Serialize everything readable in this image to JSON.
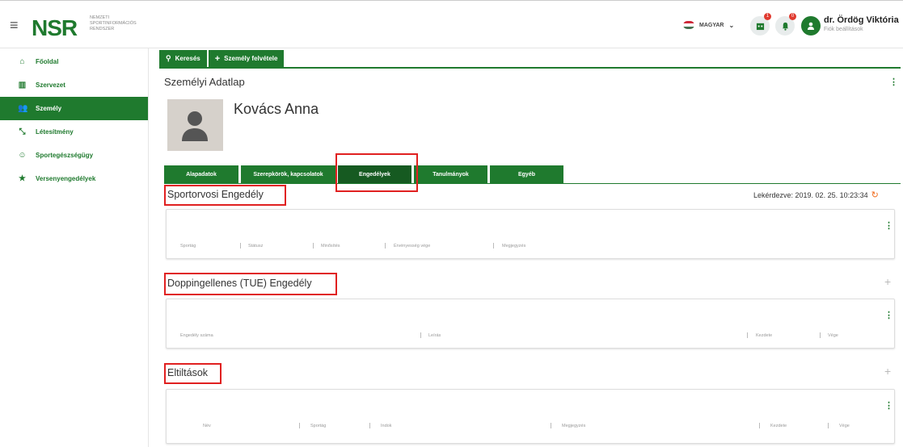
{
  "header": {
    "logo": "NSR",
    "logo_sub": [
      "NEMZETI",
      "SPORTINFORMÁCIÓS",
      "RENDSZER"
    ],
    "language": "MAGYAR",
    "badge_a": "1",
    "badge_b": "0",
    "user_name": "dr. Ördög Viktória",
    "user_sub": "Fiók beállítások"
  },
  "sidebar": {
    "items": [
      {
        "label": "Főoldal",
        "icon": "home-icon"
      },
      {
        "label": "Szervezet",
        "icon": "building-icon"
      },
      {
        "label": "Személy",
        "icon": "people-icon"
      },
      {
        "label": "Létesítmény",
        "icon": "arrows-icon"
      },
      {
        "label": "Sportegészségügy",
        "icon": "smiley-icon"
      },
      {
        "label": "Versenyengedélyek",
        "icon": "star-icon"
      }
    ]
  },
  "toptabs": {
    "search": "Keresés",
    "add_person": "Személy felvétele"
  },
  "page": {
    "title": "Személyi Adatlap",
    "person_name": "Kovács Anna"
  },
  "subtabs": [
    "Alapadatok",
    "Szerepkörök, kapcsolatok",
    "Engedélyek",
    "Tanulmányok",
    "Egyéb"
  ],
  "sections": {
    "sportorvosi": {
      "title": "Sportorvosi Engedély",
      "meta": "Lekérdezve: 2019. 02. 25. 10:23:34",
      "columns": [
        "Sportág",
        "Státusz",
        "Minősítés",
        "Érvényesség vége",
        "Megjegyzés"
      ]
    },
    "dopping": {
      "title": "Doppingellenes (TUE) Engedély",
      "columns": [
        "Engedély száma",
        "Leírás",
        "Kezdete",
        "Vége"
      ]
    },
    "eltiltasok": {
      "title": "Eltiltások",
      "columns": [
        "Név",
        "Sportág",
        "Indok",
        "Megjegyzés",
        "Kezdete",
        "Vége"
      ]
    }
  },
  "colors": {
    "brand_green": "#1f7a2e",
    "highlight_red": "#e02020",
    "refresh_orange": "#f06a1a"
  }
}
